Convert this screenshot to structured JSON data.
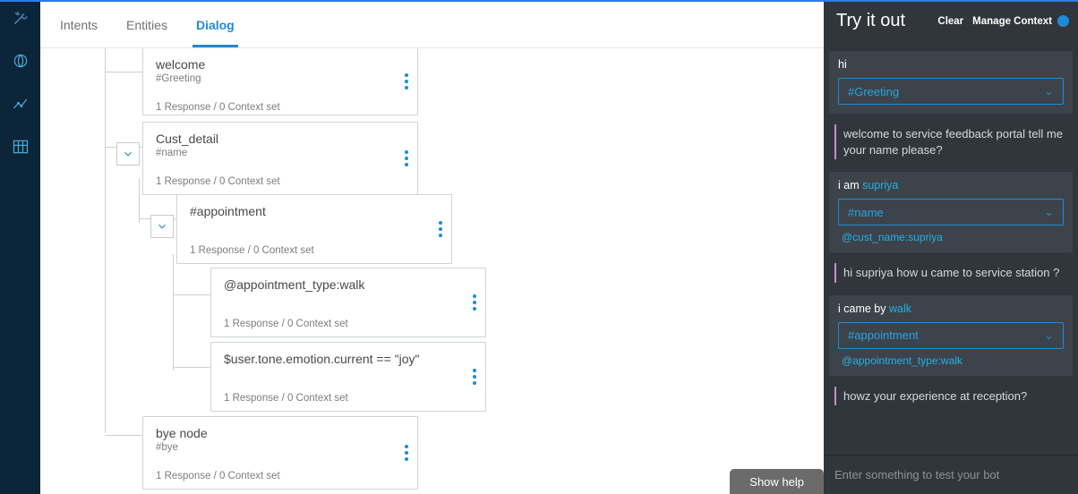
{
  "tabs": {
    "intents": "Intents",
    "entities": "Entities",
    "dialog": "Dialog"
  },
  "nodes": {
    "welcome": {
      "title": "welcome",
      "sub": "#Greeting",
      "meta": "1 Response   /   0 Context set"
    },
    "cust_detail": {
      "title": "Cust_detail",
      "sub": "#name",
      "meta": "1 Response   /   0 Context set"
    },
    "appointment": {
      "title": "#appointment",
      "sub": "",
      "meta": "1 Response   /   0 Context set"
    },
    "appt_walk": {
      "title": "@appointment_type:walk",
      "sub": "",
      "meta": "1 Response   /   0 Context set"
    },
    "tone_joy": {
      "title": "$user.tone.emotion.current == \"joy\"",
      "sub": "",
      "meta": "1 Response   /   0 Context set"
    },
    "bye": {
      "title": "bye node",
      "sub": "#bye",
      "meta": "1 Response   /   0 Context set"
    }
  },
  "showhelp": "Show help",
  "try": {
    "title": "Try it out",
    "clear": "Clear",
    "manage": "Manage Context",
    "input_placeholder": "Enter something to test your bot",
    "items": [
      {
        "type": "user",
        "text_pre": "hi",
        "text_entity": "",
        "intent": "#Greeting",
        "ctx": ""
      },
      {
        "type": "bot",
        "text": "welcome to service feedback portal tell me your name please?"
      },
      {
        "type": "user",
        "text_pre": "i am ",
        "text_entity": "supriya",
        "intent": "#name",
        "ctx": "@cust_name:supriya"
      },
      {
        "type": "bot",
        "text": "hi supriya how u came to service station ?"
      },
      {
        "type": "user",
        "text_pre": "i came by ",
        "text_entity": "walk",
        "intent": "#appointment",
        "ctx": "@appointment_type:walk"
      },
      {
        "type": "bot",
        "text": "howz your experience at reception?"
      }
    ]
  }
}
